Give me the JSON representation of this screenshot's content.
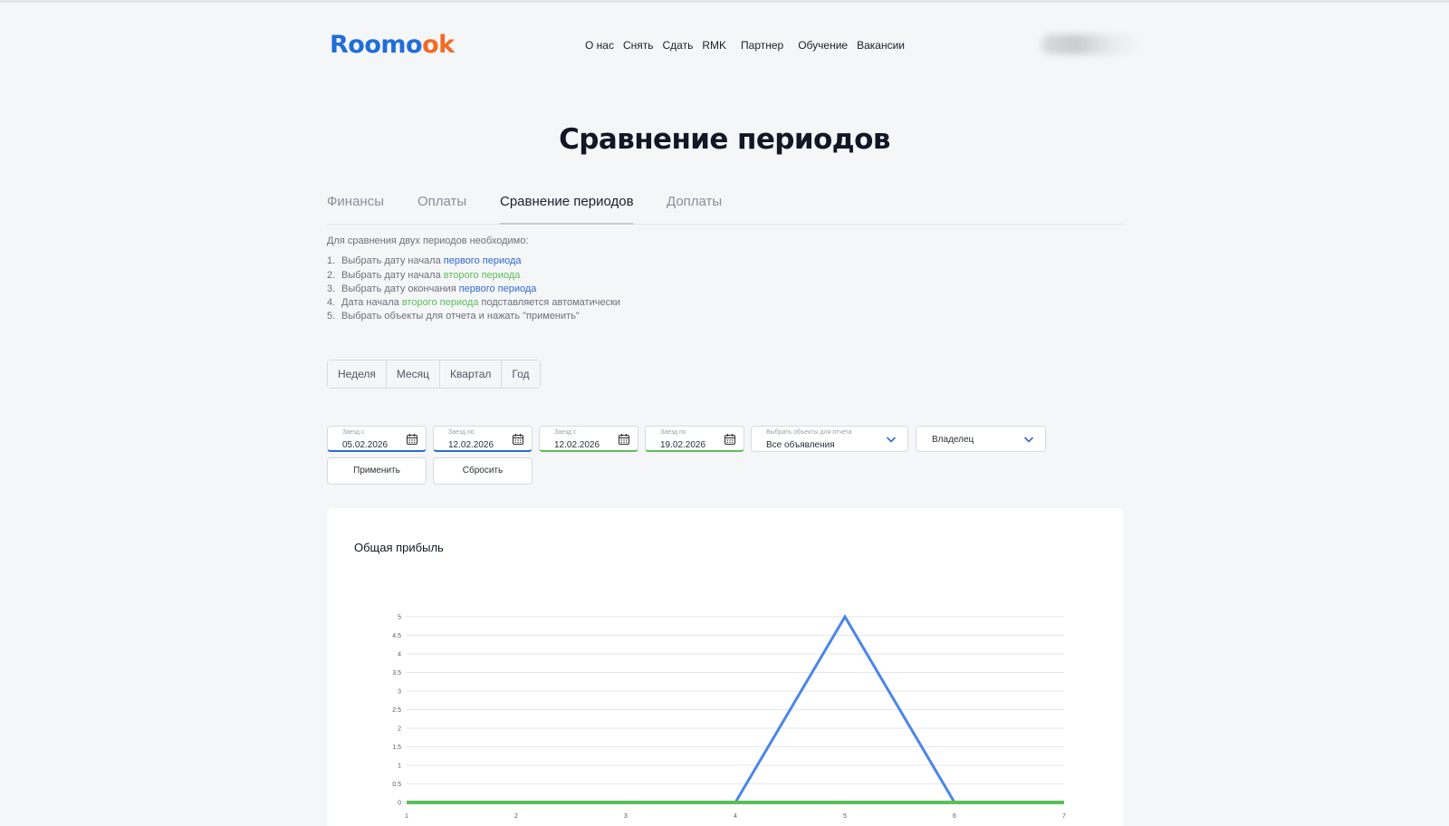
{
  "header": {
    "logo_part1": "Roomo",
    "logo_part2": "ok",
    "nav": [
      "О нас",
      "Снять",
      "Сдать",
      "RMK",
      "Партнер",
      "Обучение",
      "Вакансии"
    ]
  },
  "page": {
    "title": "Сравнение периодов"
  },
  "tabs": [
    {
      "label": "Финансы",
      "active": false
    },
    {
      "label": "Оплаты",
      "active": false
    },
    {
      "label": "Сравнение периодов",
      "active": true
    },
    {
      "label": "Доплаты",
      "active": false
    }
  ],
  "instructions": {
    "intro": "Для сравнения двух периодов необходимо:",
    "steps": [
      {
        "num": "1.",
        "pre": "Выбрать дату начала ",
        "hl": "первого периода",
        "hl_color": "blue",
        "post": ""
      },
      {
        "num": "2.",
        "pre": "Выбрать дату начала ",
        "hl": "второго периода",
        "hl_color": "green",
        "post": ""
      },
      {
        "num": "3.",
        "pre": "Выбрать дату окончания ",
        "hl": "первого периода",
        "hl_color": "blue",
        "post": ""
      },
      {
        "num": "4.",
        "pre": "Дата начала ",
        "hl": "второго периода",
        "hl_color": "green",
        "post": " подставляется автоматически"
      },
      {
        "num": "5.",
        "pre": "Выбрать объекты для отчета и нажать \"применить\"",
        "hl": "",
        "hl_color": "",
        "post": ""
      }
    ]
  },
  "period_buttons": [
    "Неделя",
    "Месяц",
    "Квартал",
    "Год"
  ],
  "filters": {
    "date1": {
      "label": "Заезд с",
      "value": "05.02.2026"
    },
    "date2": {
      "label": "Заезд по",
      "value": "12.02.2026"
    },
    "date3": {
      "label": "Заезд с",
      "value": "12.02.2026"
    },
    "date4": {
      "label": "Заезд по",
      "value": "19.02.2026"
    },
    "objects": {
      "label": "Выбрать объекты для отчета",
      "value": "Все объявления"
    },
    "owner": {
      "value": "Владелец"
    }
  },
  "actions": {
    "apply": "Применить",
    "reset": "Сбросить"
  },
  "colors": {
    "first_period": "#4a86e8",
    "second_period": "#5bbf57",
    "brand_blue": "#1f6ed8",
    "brand_orange": "#f26b24"
  },
  "chart_data": {
    "type": "line",
    "title": "Общая прибыль",
    "x": [
      1,
      2,
      3,
      4,
      5,
      6,
      7
    ],
    "ylim": [
      0,
      5
    ],
    "yticks": [
      0,
      0.5,
      1,
      1.5,
      2,
      2.5,
      3,
      3.5,
      4,
      4.5,
      5
    ],
    "grid": true,
    "series": [
      {
        "values": [
          0,
          0,
          0,
          0,
          5,
          0,
          0
        ],
        "color": "#4a86e8"
      },
      {
        "values": [
          0,
          0,
          0,
          0,
          0,
          0,
          0
        ],
        "color": "#5bbf57"
      }
    ]
  }
}
